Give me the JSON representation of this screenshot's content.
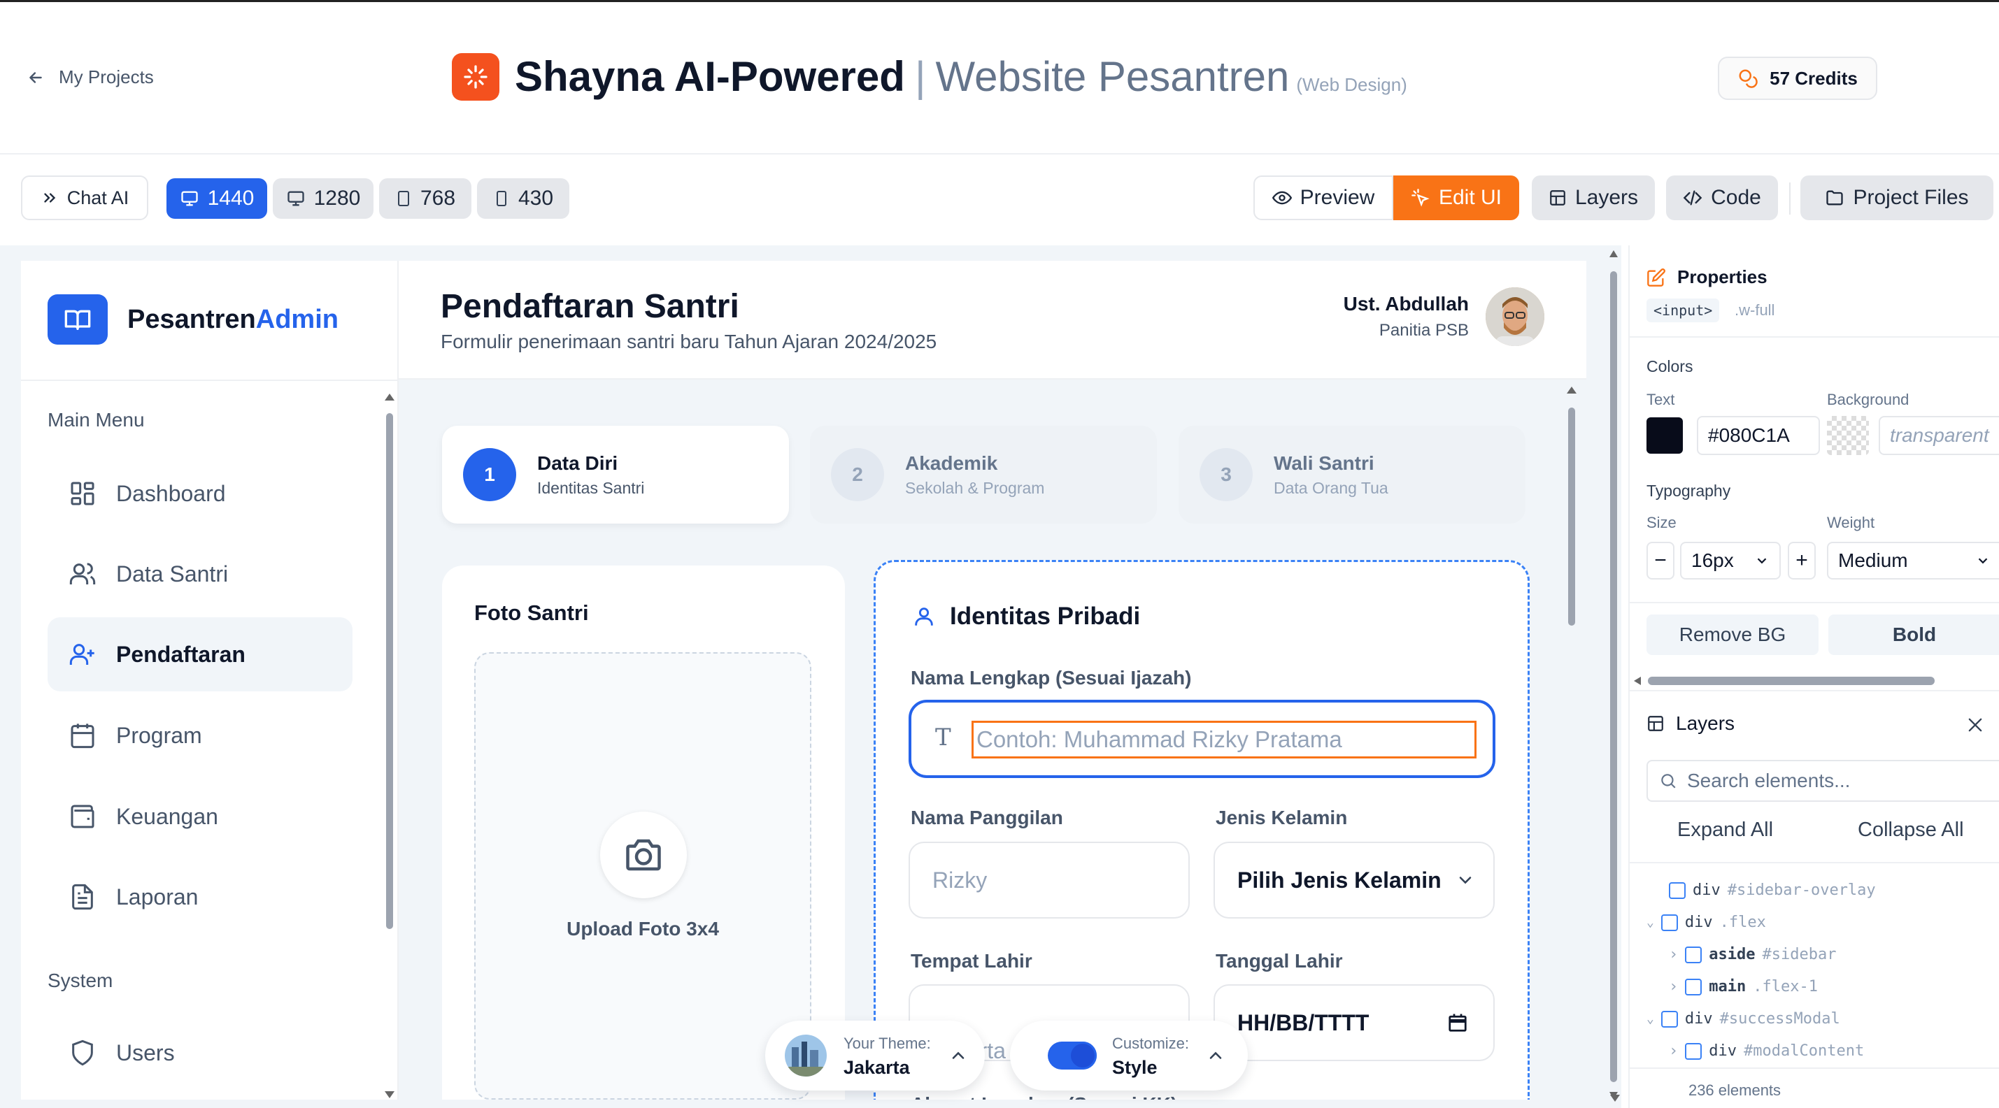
{
  "header": {
    "back_label": "My Projects",
    "title_main": "Shayna AI-Powered",
    "title_sep": "|",
    "title_sub": "Website Pesantren",
    "title_tag": "(Web Design)",
    "credits": "57 Credits"
  },
  "toolbar": {
    "chat": "Chat AI",
    "sizes": [
      "1440",
      "1280",
      "768",
      "430"
    ],
    "preview": "Preview",
    "edit": "Edit UI",
    "layers": "Layers",
    "code": "Code",
    "files": "Project Files"
  },
  "app": {
    "brand_a": "Pesantren",
    "brand_b": "Admin",
    "main_menu_label": "Main Menu",
    "nav": [
      "Dashboard",
      "Data Santri",
      "Pendaftaran",
      "Program",
      "Keuangan",
      "Laporan"
    ],
    "system_label": "System",
    "system_nav": [
      "Users"
    ],
    "page_title": "Pendaftaran Santri",
    "page_subtitle": "Formulir penerimaan santri baru Tahun Ajaran 2024/2025",
    "user_name": "Ust. Abdullah",
    "user_role": "Panitia PSB",
    "steps": [
      {
        "num": "1",
        "title": "Data Diri",
        "sub": "Identitas Santri"
      },
      {
        "num": "2",
        "title": "Akademik",
        "sub": "Sekolah & Program"
      },
      {
        "num": "3",
        "title": "Wali Santri",
        "sub": "Data Orang Tua"
      }
    ],
    "photo_title": "Foto Santri",
    "upload_label": "Upload Foto 3x4",
    "form_title": "Identitas Pribadi",
    "full_name_label": "Nama Lengkap (Sesuai Ijazah)",
    "full_name_placeholder": "Contoh: Muhammad Rizky Pratama",
    "nickname_label": "Nama Panggilan",
    "nickname_placeholder": "Rizky",
    "gender_label": "Jenis Kelamin",
    "gender_value": "Pilih Jenis Kelamin",
    "birthplace_label": "Tempat Lahir",
    "birthplace_placeholder": "Jakarta",
    "birthdate_label": "Tanggal Lahir",
    "birthdate_value": "HH/BB/TTTT",
    "address_label": "Alamat Lengkap (Sesuai KK)"
  },
  "floating": {
    "theme_label": "Your Theme:",
    "theme_value": "Jakarta",
    "customize_label": "Customize:",
    "customize_value": "Style"
  },
  "properties": {
    "title": "Properties",
    "tag": "<input>",
    "class": ".w-full",
    "colors_label": "Colors",
    "text_label": "Text",
    "background_label": "Background",
    "text_color": "#080C1A",
    "background_value": "transparent",
    "typography_label": "Typography",
    "size_label": "Size",
    "weight_label": "Weight",
    "size_value": "16px",
    "weight_value": "Medium",
    "remove_bg": "Remove BG",
    "bold": "Bold"
  },
  "layers": {
    "title": "Layers",
    "search_placeholder": "Search elements...",
    "expand_all": "Expand All",
    "collapse_all": "Collapse All",
    "tree": [
      {
        "tag": "div",
        "sel": "#sidebar-overlay"
      },
      {
        "tag": "div",
        "sel": ".flex"
      },
      {
        "tag": "aside",
        "sel": "#sidebar"
      },
      {
        "tag": "main",
        "sel": ".flex-1"
      },
      {
        "tag": "div",
        "sel": "#successModal"
      },
      {
        "tag": "div",
        "sel": "#modalContent"
      }
    ],
    "count": "236 elements"
  },
  "colors": {
    "primary": "#2563eb",
    "accent": "#f97316",
    "brand_logo": "#f4511e",
    "text_swatch": "#080C1A"
  }
}
